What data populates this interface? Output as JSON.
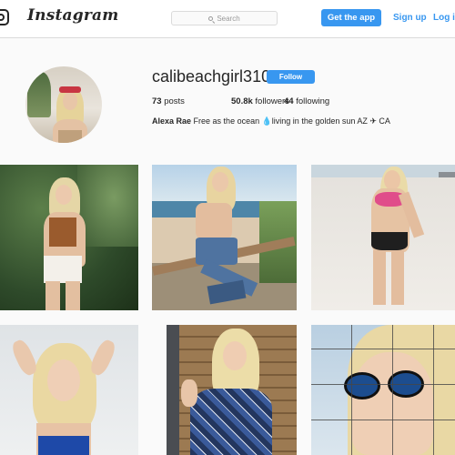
{
  "topbar": {
    "wordmark": "Instagram",
    "search_placeholder": "Search",
    "get_app_label": "Get the app",
    "signup_label": "Sign up",
    "login_label": "Log in"
  },
  "profile": {
    "username": "calibeachgirl310",
    "follow_label": "Follow",
    "stats": {
      "posts_count": "73",
      "posts_label": "posts",
      "followers_count": "50.8k",
      "followers_label": "followers",
      "following_count": "44",
      "following_label": "following"
    },
    "full_name": "Alexa Rae",
    "bio_text": "Free as the ocean 💧living in the golden sun AZ ✈ CA"
  },
  "posts": [
    {
      "subject": "woman in brown halter top and white shorts among palm fronds"
    },
    {
      "subject": "woman in jeans sitting on wooden railing by the beach"
    },
    {
      "subject": "woman in pink and black bikini on the beach"
    },
    {
      "subject": "woman with hands in hair wearing blue top"
    },
    {
      "subject": "woman in blue plaid shirt by a wooden wall"
    },
    {
      "subject": "woman in mirrored sunglasses behind a wire fence"
    }
  ],
  "colors": {
    "brand_blue": "#3897f0",
    "border": "#dbdbdb",
    "background": "#fafafa",
    "text": "#262626"
  }
}
